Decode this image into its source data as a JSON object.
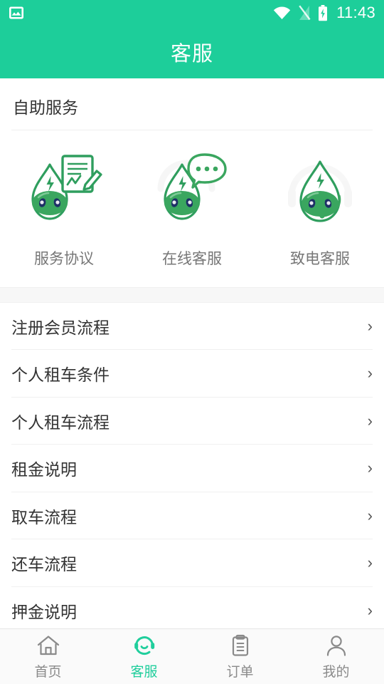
{
  "theme": {
    "brand_green": "#1DCE9A",
    "accent_green": "#20CE9C",
    "text_dark": "#333333",
    "text_muted": "#777777",
    "tab_inactive": "#8a8a8a",
    "band_gray": "#f7f7f7"
  },
  "status_bar": {
    "screenshot_icon": "image-icon",
    "wifi_icon": "wifi-icon",
    "signal_icon": "signal-off-icon",
    "battery_icon": "battery-charging-icon",
    "time": "11:43"
  },
  "header": {
    "title": "客服"
  },
  "self_service": {
    "section_title": "自助服务",
    "items": [
      {
        "label": "服务协议",
        "icon": "mascot-document-icon"
      },
      {
        "label": "在线客服",
        "icon": "mascot-chat-icon"
      },
      {
        "label": "致电客服",
        "icon": "mascot-headset-icon"
      }
    ]
  },
  "faq": {
    "chevron": "›",
    "items": [
      {
        "label": "注册会员流程"
      },
      {
        "label": "个人租车条件"
      },
      {
        "label": "个人租车流程"
      },
      {
        "label": "租金说明"
      },
      {
        "label": "取车流程"
      },
      {
        "label": "还车流程"
      },
      {
        "label": "押金说明"
      }
    ]
  },
  "tab_bar": {
    "items": [
      {
        "label": "首页",
        "icon": "home-icon",
        "active": false
      },
      {
        "label": "客服",
        "icon": "headset-icon",
        "active": true
      },
      {
        "label": "订单",
        "icon": "clipboard-icon",
        "active": false
      },
      {
        "label": "我的",
        "icon": "person-icon",
        "active": false
      }
    ]
  }
}
